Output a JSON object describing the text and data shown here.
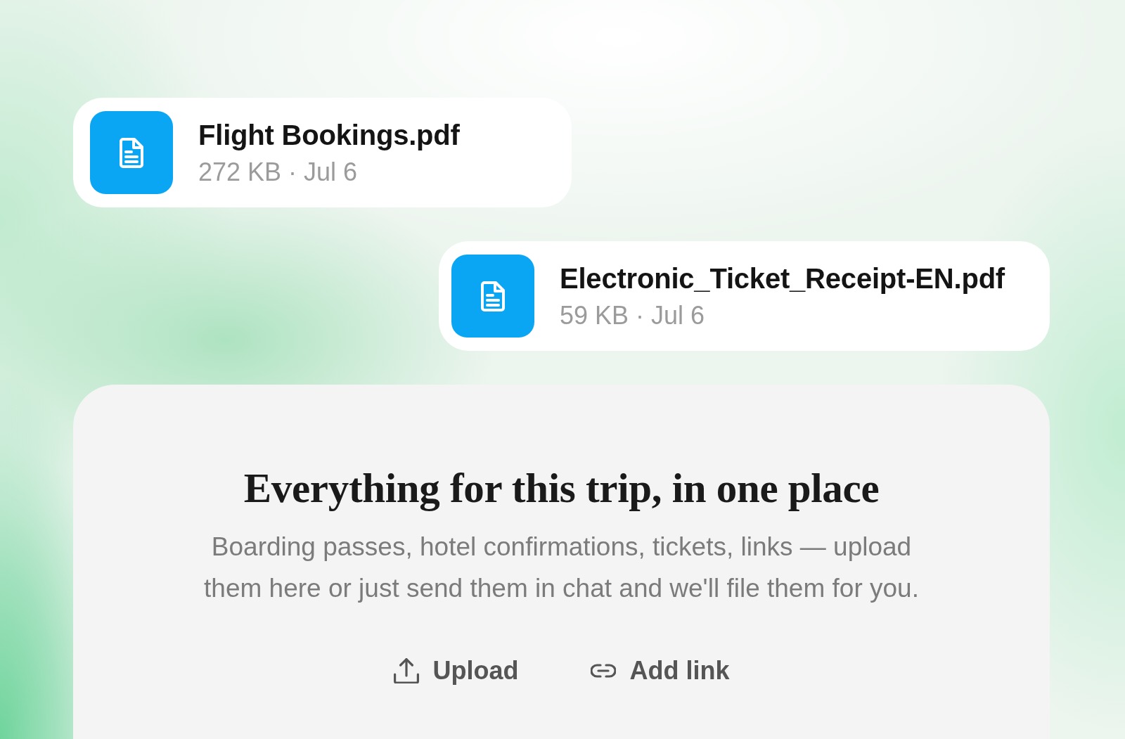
{
  "files": [
    {
      "name": "Flight Bookings.pdf",
      "meta": "272 KB · Jul 6"
    },
    {
      "name": "Electronic_Ticket_Receipt-EN.pdf",
      "meta": "59 KB · Jul 6"
    }
  ],
  "panel": {
    "title": "Everything for this trip, in one place",
    "description": "Boarding passes, hotel confirmations, tickets, links — upload them here or just send them in chat and we'll file them for you.",
    "actions": [
      {
        "kind": "upload",
        "label": "Upload"
      },
      {
        "kind": "link",
        "label": "Add link"
      }
    ]
  }
}
